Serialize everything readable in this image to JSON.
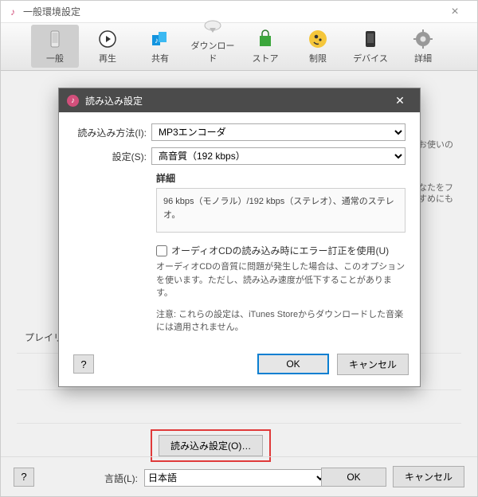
{
  "parent": {
    "title": "一般環境設定",
    "tabs": [
      {
        "label": "一般"
      },
      {
        "label": "再生"
      },
      {
        "label": "共有"
      },
      {
        "label": "ダウンロード"
      },
      {
        "label": "ストア"
      },
      {
        "label": "制限"
      },
      {
        "label": "デバイス"
      },
      {
        "label": "詳細"
      }
    ],
    "bg_text": {
      "line1": "をお使いの",
      "line2": "なたをフ",
      "line3": "すすめにも"
    },
    "playlist_label": "プレイリスト",
    "import_button": "読み込み設定(O)…",
    "lang_label": "言語(L):",
    "lang_value": "日本語",
    "help": "?",
    "ok": "OK",
    "cancel": "キャンセル"
  },
  "dialog": {
    "title": "読み込み設定",
    "method_label": "読み込み方法(I):",
    "method_value": "MP3エンコーダ",
    "setting_label": "設定(S):",
    "setting_value": "高音質（192 kbps）",
    "details_heading": "詳細",
    "details_text": "96 kbps（モノラル）/192 kbps（ステレオ）、通常のステレオ。",
    "error_correction_label": "オーディオCDの読み込み時にエラー訂正を使用(U)",
    "ec_note": "オーディオCDの音質に問題が発生した場合は、このオプションを使います。ただし、読み込み速度が低下することがあります。",
    "store_note": "注意: これらの設定は、iTunes Storeからダウンロードした音楽には適用されません。",
    "help": "?",
    "ok": "OK",
    "cancel": "キャンセル"
  }
}
